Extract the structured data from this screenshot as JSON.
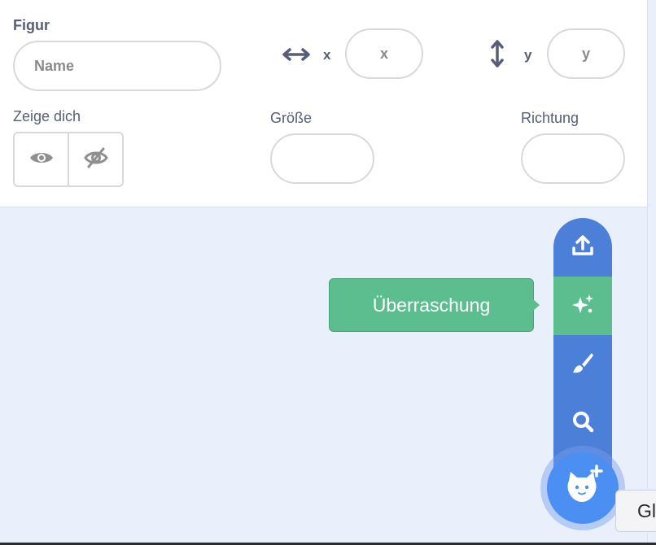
{
  "sprite_info": {
    "sprite_label": "Figur",
    "name_placeholder": "Name",
    "x_label": "x",
    "x_placeholder": "x",
    "y_label": "y",
    "y_placeholder": "y",
    "show_label": "Zeige dich",
    "size_label": "Größe",
    "direction_label": "Richtung"
  },
  "sprite_menu": {
    "items": [
      {
        "name": "upload",
        "icon": "upload-icon"
      },
      {
        "name": "surprise",
        "icon": "sparkles-icon",
        "active": true
      },
      {
        "name": "paint",
        "icon": "brush-icon"
      },
      {
        "name": "search",
        "icon": "search-icon"
      }
    ],
    "choose_icon": "cat-plus-icon"
  },
  "tooltip": {
    "text": "Überraschung"
  },
  "side_tab": {
    "text": "Gl"
  },
  "colors": {
    "menu_blue": "#4c7fd8",
    "active_green": "#5cbd8e",
    "text": "#575e75"
  }
}
